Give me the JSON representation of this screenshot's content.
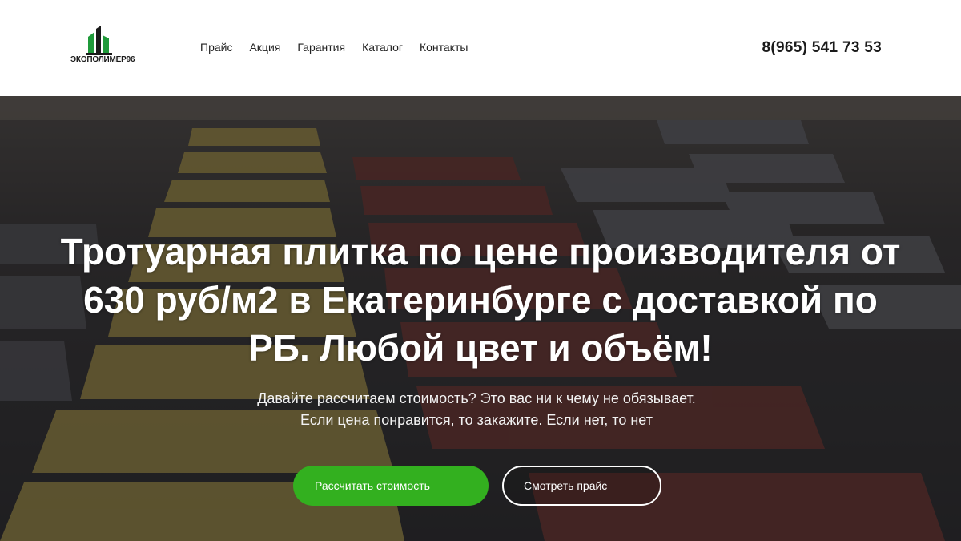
{
  "header": {
    "logo_text": "ЭКОПОЛИМЕР96",
    "nav": [
      {
        "label": "Прайс"
      },
      {
        "label": "Акция"
      },
      {
        "label": "Гарантия"
      },
      {
        "label": "Каталог"
      },
      {
        "label": "Контакты"
      }
    ],
    "phone": "8(965) 541 73 53"
  },
  "hero": {
    "title": "Тротуарная плитка по цене производителя от 630 руб/м2 в Екатеринбурге с доставкой по РБ. Любой цвет и объём!",
    "subtitle_line1": "Давайте рассчитаем стоимость? Это вас ни к чему не обязывает.",
    "subtitle_line2": "Если цена понравится, то закажите. Если нет, то нет",
    "primary_button": "Рассчитать стоимость",
    "secondary_button": "Смотреть прайс"
  },
  "colors": {
    "accent": "#33b01f",
    "logo_green": "#1f9a3a"
  }
}
